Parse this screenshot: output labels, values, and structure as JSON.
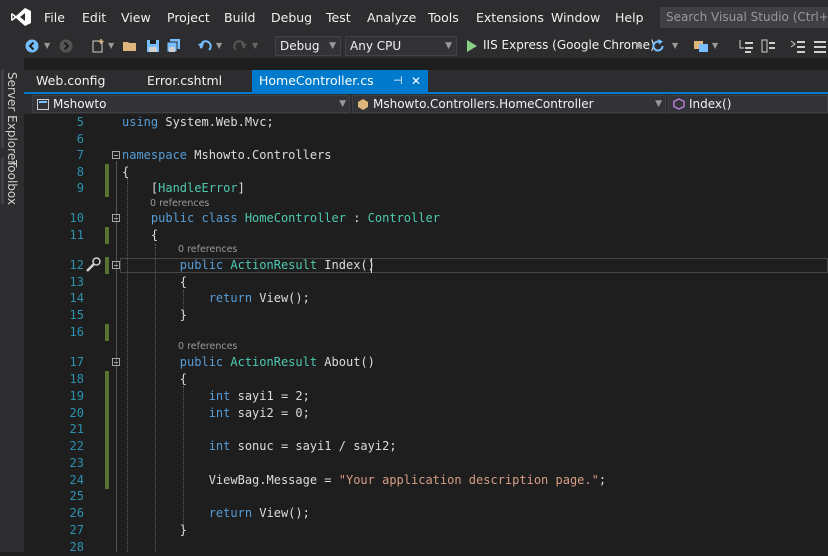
{
  "menubar": {
    "items": [
      "File",
      "Edit",
      "View",
      "Project",
      "Build",
      "Debug",
      "Test",
      "Analyze",
      "Tools",
      "Extensions",
      "Window",
      "Help"
    ],
    "search_placeholder": "Search Visual Studio (Ctrl+Q)"
  },
  "toolbar": {
    "config": "Debug",
    "platform": "Any CPU",
    "run_target": "IIS Express (Google Chrome)"
  },
  "sidebar": {
    "server_explorer": "Server Explorer",
    "toolbox": "Toolbox"
  },
  "tabs": [
    {
      "label": "Web.config"
    },
    {
      "label": "Error.cshtml"
    },
    {
      "label": "HomeController.cs",
      "active": true,
      "pin": "⊣",
      "close": "✕"
    }
  ],
  "navbar": {
    "project": "Mshowto",
    "type": "Mshowto.Controllers.HomeController",
    "member": "Index()"
  },
  "code": {
    "lines": [
      {
        "n": "5",
        "segs": [
          {
            "c": "k",
            "t": "using"
          },
          {
            "t": " System.Web.Mvc;"
          }
        ]
      },
      {
        "n": "6",
        "segs": []
      },
      {
        "n": "7",
        "segs": [
          {
            "c": "k",
            "t": "namespace"
          },
          {
            "t": " Mshowto.Controllers"
          }
        ]
      },
      {
        "n": "8",
        "segs": [
          {
            "t": "{"
          }
        ]
      },
      {
        "n": "9",
        "segs": [
          {
            "t": "    ["
          },
          {
            "c": "t",
            "t": "HandleError"
          },
          {
            "t": "]"
          }
        ]
      },
      {
        "n": "10",
        "segs": [
          {
            "c": "k",
            "t": "    public class "
          },
          {
            "c": "t",
            "t": "HomeController"
          },
          {
            "t": " : "
          },
          {
            "c": "t",
            "t": "Controller"
          }
        ]
      },
      {
        "n": "11",
        "segs": [
          {
            "t": "    {"
          }
        ]
      },
      {
        "n": "12",
        "segs": [
          {
            "c": "k",
            "t": "        public "
          },
          {
            "c": "t",
            "t": "ActionResult"
          },
          {
            "t": " Index()"
          }
        ]
      },
      {
        "n": "13",
        "segs": [
          {
            "t": "        {"
          }
        ]
      },
      {
        "n": "14",
        "segs": [
          {
            "c": "k",
            "t": "            return "
          },
          {
            "t": "View();"
          }
        ]
      },
      {
        "n": "15",
        "segs": [
          {
            "t": "        }"
          }
        ]
      },
      {
        "n": "16",
        "segs": []
      },
      {
        "n": "17",
        "segs": [
          {
            "c": "k",
            "t": "        public "
          },
          {
            "c": "t",
            "t": "ActionResult"
          },
          {
            "t": " About()"
          }
        ]
      },
      {
        "n": "18",
        "segs": [
          {
            "t": "        {"
          }
        ]
      },
      {
        "n": "19",
        "segs": [
          {
            "c": "k",
            "t": "            int"
          },
          {
            "t": " sayi1 = 2;"
          }
        ]
      },
      {
        "n": "20",
        "segs": [
          {
            "c": "k",
            "t": "            int"
          },
          {
            "t": " sayi2 = 0;"
          }
        ]
      },
      {
        "n": "21",
        "segs": []
      },
      {
        "n": "22",
        "segs": [
          {
            "c": "k",
            "t": "            int"
          },
          {
            "t": " sonuc = sayi1 / sayi2;"
          }
        ]
      },
      {
        "n": "23",
        "segs": []
      },
      {
        "n": "24",
        "segs": [
          {
            "t": "            ViewBag.Message = "
          },
          {
            "c": "s",
            "t": "\"Your application description page.\""
          },
          {
            "t": ";"
          }
        ]
      },
      {
        "n": "25",
        "segs": []
      },
      {
        "n": "26",
        "segs": [
          {
            "c": "k",
            "t": "            return "
          },
          {
            "t": "View();"
          }
        ]
      },
      {
        "n": "27",
        "segs": [
          {
            "t": "        }"
          }
        ]
      },
      {
        "n": "28",
        "segs": []
      }
    ],
    "lens_text": "0 references"
  },
  "colors": {
    "accent": "#007acc",
    "keyword": "#569cd6",
    "type": "#4ec9b0",
    "string": "#d69d85",
    "line_number": "#2b91af",
    "change_bar": "#577430"
  }
}
